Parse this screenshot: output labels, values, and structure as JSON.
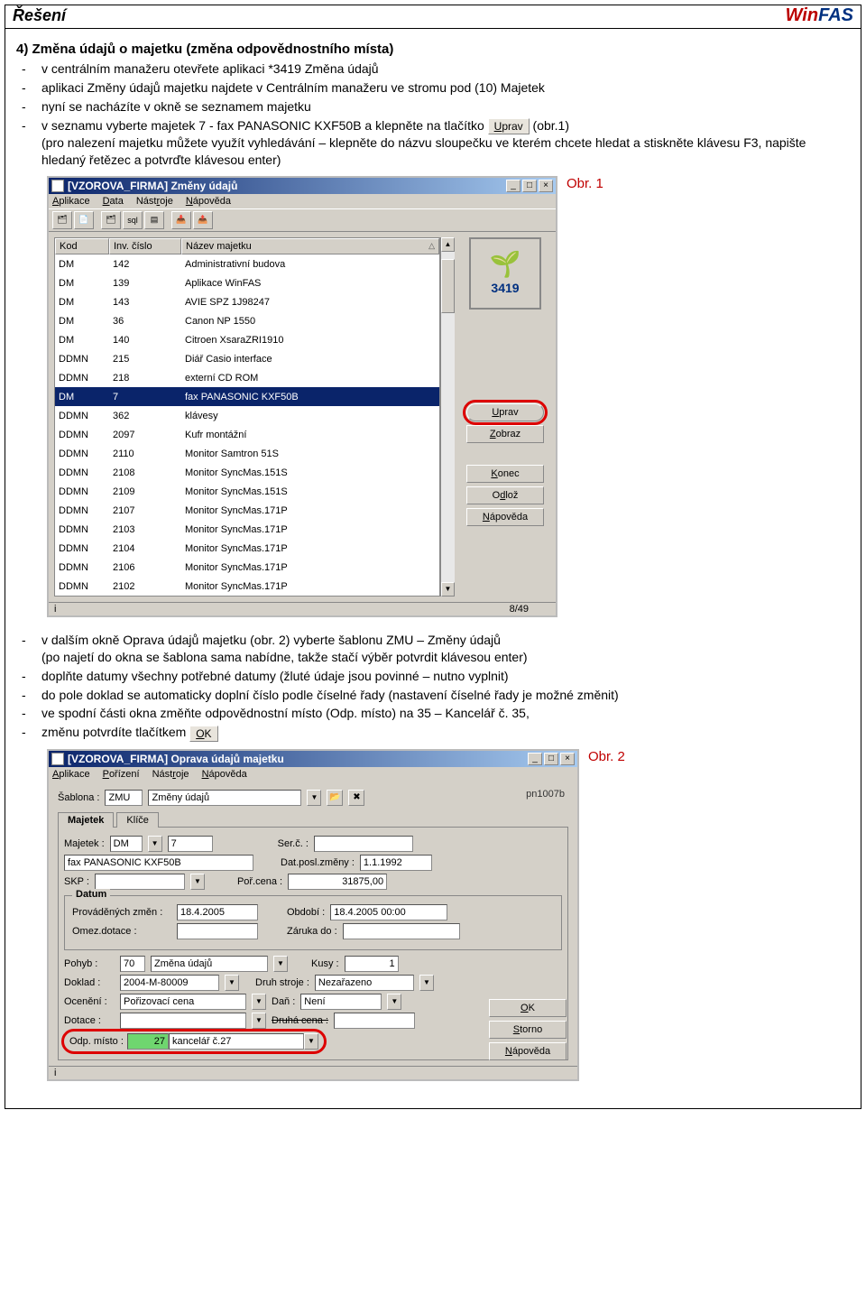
{
  "header": {
    "left": "Řešení",
    "right_win": "Win",
    "right_fas": "FAS"
  },
  "section4_title": "4)  Změna údajů o majetku (změna odpovědnostního místa)",
  "bullets1": [
    "v centrálním manažeru otevřete aplikaci *3419 Změna údajů",
    "aplikaci Změny údajů majetku najdete v Centrálním manažeru ve stromu pod (10) Majetek",
    "nyní se nacházíte v okně se seznamem majetku"
  ],
  "bullet_fax_prefix": "v seznamu vyberte majetek 7 - fax PANASONIC KXF50B a klepněte na tlačítko ",
  "btn_uprav_inline": "Uprav",
  "bullet_fax_suffix": " (obr.1)",
  "bullet_fax_note": "(pro nalezení majetku můžete využít vyhledávání – klepněte do názvu sloupečku ve kterém chcete hledat a stiskněte klávesu F3, napište hledaný řetězec a potvrďte klávesou enter)",
  "fig1_label": "Obr. 1",
  "window1": {
    "title": "[VZOROVA_FIRMA] Změny údajů",
    "menus": [
      "Aplikace",
      "Data",
      "Nástroje",
      "Nápověda"
    ],
    "cols": {
      "kod": "Kod",
      "inv": "Inv. číslo",
      "nazev": "Název majetku"
    },
    "rows": [
      {
        "kod": "DM",
        "inv": "142",
        "naz": "Administrativní budova"
      },
      {
        "kod": "DM",
        "inv": "139",
        "naz": "Aplikace WinFAS"
      },
      {
        "kod": "DM",
        "inv": "143",
        "naz": "AVIE  SPZ 1J98247"
      },
      {
        "kod": "DM",
        "inv": "36",
        "naz": "Canon NP 1550"
      },
      {
        "kod": "DM",
        "inv": "140",
        "naz": "Citroen XsaraZRI1910"
      },
      {
        "kod": "DDMN",
        "inv": "215",
        "naz": "Diář Casio interface"
      },
      {
        "kod": "DDMN",
        "inv": "218",
        "naz": "externí CD ROM"
      },
      {
        "kod": "DM",
        "inv": "7",
        "naz": "fax PANASONIC KXF50B"
      },
      {
        "kod": "DDMN",
        "inv": "362",
        "naz": "klávesy"
      },
      {
        "kod": "DDMN",
        "inv": "2097",
        "naz": "Kufr montážní"
      },
      {
        "kod": "DDMN",
        "inv": "2110",
        "naz": "Monitor Samtron  51S"
      },
      {
        "kod": "DDMN",
        "inv": "2108",
        "naz": "Monitor SyncMas.151S"
      },
      {
        "kod": "DDMN",
        "inv": "2109",
        "naz": "Monitor SyncMas.151S"
      },
      {
        "kod": "DDMN",
        "inv": "2107",
        "naz": "Monitor SyncMas.171P"
      },
      {
        "kod": "DDMN",
        "inv": "2103",
        "naz": "Monitor SyncMas.171P"
      },
      {
        "kod": "DDMN",
        "inv": "2104",
        "naz": "Monitor SyncMas.171P"
      },
      {
        "kod": "DDMN",
        "inv": "2106",
        "naz": "Monitor SyncMas.171P"
      },
      {
        "kod": "DDMN",
        "inv": "2102",
        "naz": "Monitor SyncMas.171P"
      }
    ],
    "selected_index": 7,
    "logo_num": "3419",
    "side_btns": [
      "Uprav",
      "Zobraz",
      "Konec",
      "Odlož",
      "Nápověda"
    ],
    "status_info": "i",
    "status_page": "8/49"
  },
  "bullets2_0": "v dalším okně Oprava údajů majetku (obr. 2) vyberte šablonu ZMU – Změny údajů",
  "bullets2_0_note": "(po najetí do okna se šablona sama nabídne, takže stačí výběr potvrdit klávesou enter)",
  "bullets2_1": "doplňte datumy všechny potřebné datumy (žluté údaje jsou povinné – nutno vyplnit)",
  "bullets2_2": "do pole doklad se automaticky doplní číslo podle číselné řady (nastavení číselné řady je možné změnit)",
  "bullets2_3": "ve spodní části okna změňte odpovědnostní místo (Odp. místo) na 35 – Kancelář č. 35,",
  "bullets2_4_prefix": "změnu potvrdíte tlačítkem ",
  "btn_ok_inline": "OK",
  "fig2_label": "Obr. 2",
  "window2": {
    "title": "[VZOROVA_FIRMA] Oprava údajů majetku",
    "menus": [
      "Aplikace",
      "Pořízení",
      "Nástroje",
      "Nápověda"
    ],
    "doc_id": "pn1007b",
    "sablona_lbl": "Šablona :",
    "sablona_code": "ZMU",
    "sablona_name": "Změny údajů",
    "tab1": "Majetek",
    "tab2": "Klíče",
    "majetek_lbl": "Majetek :",
    "majetek_code": "DM",
    "majetek_inv": "7",
    "serc_lbl": "Ser.č. :",
    "majetek_name": "fax PANASONIC KXF50B",
    "datposl_lbl": "Dat.posl.změny :",
    "datposl_val": "1.1.1992",
    "skp_lbl": "SKP :",
    "porcena_lbl": "Poř.cena :",
    "porcena_val": "31875,00",
    "group_datum": "Datum",
    "prov_lbl": "Prováděných změn :",
    "prov_val": "18.4.2005",
    "obdobi_lbl": "Období :",
    "obdobi_val": "18.4.2005 00:00",
    "omez_lbl": "Omez.dotace :",
    "zaruka_lbl": "Záruka do :",
    "pohyb_lbl": "Pohyb :",
    "pohyb_code": "70",
    "pohyb_name": "Změna údajů",
    "kusy_lbl": "Kusy :",
    "kusy_val": "1",
    "doklad_lbl": "Doklad :",
    "doklad_val": "2004-M-80009",
    "druhstroje_lbl": "Druh stroje :",
    "druhstroje_val": "Nezařazeno",
    "oceneni_lbl": "Ocenění :",
    "oceneni_val": "Pořizovací cena",
    "dan_lbl": "Daň :",
    "dan_val": "Není",
    "dotace_lbl": "Dotace :",
    "druhacena_lbl": "Druhá cena :",
    "odpmisto_lbl": "Odp. místo :",
    "odpmisto_code": "27",
    "odpmisto_name": "kancelář č.27",
    "btn_ok": "OK",
    "btn_storno": "Storno",
    "btn_napoveda": "Nápověda",
    "status_info": "i"
  }
}
